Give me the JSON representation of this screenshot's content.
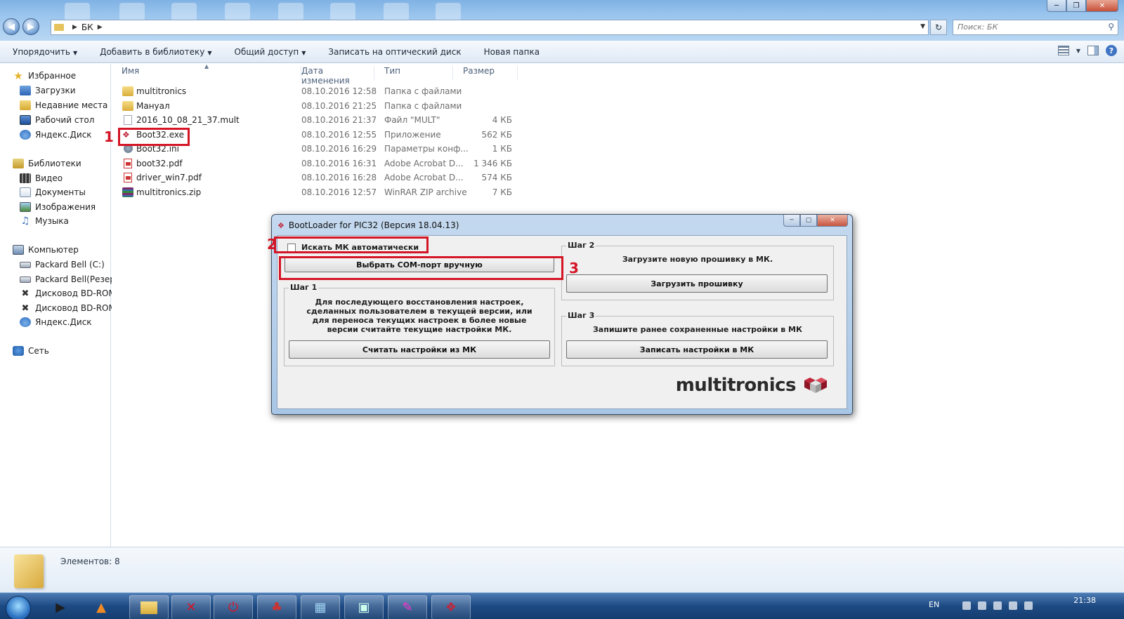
{
  "explorer": {
    "breadcrumb": [
      "БК"
    ],
    "search_placeholder": "Поиск: БК",
    "commands": [
      "Упорядочить",
      "Добавить в библиотеку",
      "Общий доступ",
      "Записать на оптический диск",
      "Новая папка"
    ],
    "nav": {
      "favorites": "Избранное",
      "favorites_items": [
        "Загрузки",
        "Недавние места",
        "Рабочий стол",
        "Яндекс.Диск"
      ],
      "libraries": "Библиотеки",
      "libraries_items": [
        "Видео",
        "Документы",
        "Изображения",
        "Музыка"
      ],
      "computer": "Компьютер",
      "computer_items": [
        "Packard Bell (C:)",
        "Packard Bell(Резерв",
        "Дисковод BD-ROM",
        "Дисковод BD-ROM",
        "Яндекс.Диск"
      ],
      "network": "Сеть"
    },
    "columns": {
      "name": "Имя",
      "date": "Дата изменения",
      "type": "Тип",
      "size": "Размер"
    },
    "files": [
      {
        "name": "multitronics",
        "date": "08.10.2016 12:58",
        "type": "Папка с файлами",
        "size": "",
        "icon": "folder"
      },
      {
        "name": "Мануал",
        "date": "08.10.2016 21:25",
        "type": "Папка с файлами",
        "size": "",
        "icon": "folder"
      },
      {
        "name": "2016_10_08_21_37.mult",
        "date": "08.10.2016 21:37",
        "type": "Файл \"MULT\"",
        "size": "4 КБ",
        "icon": "doc"
      },
      {
        "name": "Boot32.exe",
        "date": "08.10.2016 12:55",
        "type": "Приложение",
        "size": "562 КБ",
        "icon": "exe"
      },
      {
        "name": "Boot32.ini",
        "date": "08.10.2016 16:29",
        "type": "Параметры конф...",
        "size": "1 КБ",
        "icon": "ini"
      },
      {
        "name": "boot32.pdf",
        "date": "08.10.2016 16:31",
        "type": "Adobe Acrobat D...",
        "size": "1 346 КБ",
        "icon": "pdf"
      },
      {
        "name": "driver_win7.pdf",
        "date": "08.10.2016 16:28",
        "type": "Adobe Acrobat D...",
        "size": "574 КБ",
        "icon": "pdf"
      },
      {
        "name": "multitronics.zip",
        "date": "08.10.2016 12:57",
        "type": "WinRAR ZIP archive",
        "size": "7 КБ",
        "icon": "zip"
      }
    ],
    "status_count": "Элементов: 8"
  },
  "annotations": [
    "1",
    "2",
    "3"
  ],
  "dialog": {
    "title": "BootLoader for PIC32  (Версия 18.04.13)",
    "auto_search_label": "Искать МК автоматически",
    "auto_search_checked": false,
    "select_port_button": "Выбрать COM-порт вручную",
    "step1": {
      "label": "Шаг 1",
      "text": "Для последующего восстановления настроек,\nсделанных пользователем в текущей версии, или\nдля переноса текущих настроек в более новые\nверсии считайте текущие настройки МК.",
      "button": "Считать настройки из МК"
    },
    "step2": {
      "label": "Шаг 2",
      "text": "Загрузите новую прошивку в МК.",
      "button": "Загрузить прошивку"
    },
    "step3": {
      "label": "Шаг 3",
      "text": "Запишите ранее сохраненные настройки в МК",
      "button": "Записать настройки в МК"
    },
    "brand": "multitronics"
  },
  "taskbar": {
    "lang": "EN",
    "time": "21:38"
  },
  "colors": {
    "annotation_red": "#d41525",
    "brand_red": "#c2263b"
  }
}
